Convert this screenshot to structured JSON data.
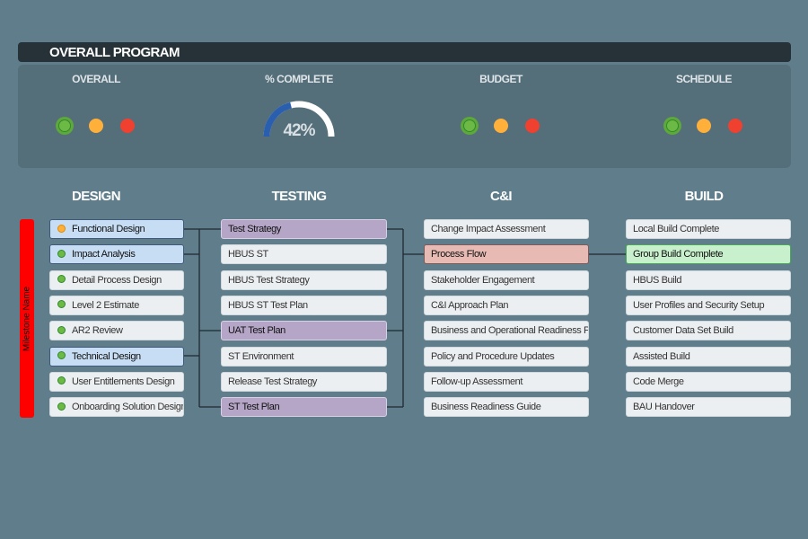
{
  "header": {
    "title": "OVERALL PROGRAM"
  },
  "kpis": {
    "overall": {
      "label": "OVERALL",
      "status": "green"
    },
    "complete": {
      "label": "% COMPLETE",
      "value": "42%",
      "percent": 42
    },
    "budget": {
      "label": "BUDGET",
      "status": "green"
    },
    "schedule": {
      "label": "SCHEDULE",
      "status": "green"
    }
  },
  "colors": {
    "green": "#6cba45",
    "amber": "#ffb03a",
    "red": "#f0402f",
    "gauge_fill": "#2a5fb0"
  },
  "milestone_label": "Milestone Name",
  "columns": [
    {
      "title": "DESIGN",
      "items": [
        {
          "label": "Functional Design",
          "status": "amber",
          "highlight": "blue"
        },
        {
          "label": "Impact Analysis",
          "status": "green",
          "highlight": "blue"
        },
        {
          "label": "Detail Process Design",
          "status": "green"
        },
        {
          "label": "Level 2 Estimate",
          "status": "green"
        },
        {
          "label": "AR2 Review",
          "status": "green"
        },
        {
          "label": "Technical Design",
          "status": "green",
          "highlight": "blue"
        },
        {
          "label": "User Entitlements Design",
          "status": "green"
        },
        {
          "label": "Onboarding Solution Design",
          "status": "green"
        }
      ]
    },
    {
      "title": "TESTING",
      "items": [
        {
          "label": "Test Strategy",
          "highlight": "purple"
        },
        {
          "label": "HBUS ST"
        },
        {
          "label": "HBUS Test Strategy"
        },
        {
          "label": "HBUS ST Test Plan"
        },
        {
          "label": "UAT Test Plan",
          "highlight": "purple"
        },
        {
          "label": "ST Environment"
        },
        {
          "label": "Release Test Strategy"
        },
        {
          "label": "ST Test Plan",
          "highlight": "purple"
        }
      ]
    },
    {
      "title": "C&I",
      "items": [
        {
          "label": "Change Impact Assessment"
        },
        {
          "label": "Process Flow",
          "highlight": "red"
        },
        {
          "label": "Stakeholder Engagement"
        },
        {
          "label": "C&I Approach Plan"
        },
        {
          "label": "Business and Operational Readiness Plan"
        },
        {
          "label": "Policy and Procedure Updates"
        },
        {
          "label": "Follow-up Assessment"
        },
        {
          "label": "Business Readiness Guide"
        }
      ]
    },
    {
      "title": "BUILD",
      "items": [
        {
          "label": "Local Build Complete"
        },
        {
          "label": "Group Build Complete",
          "highlight": "green"
        },
        {
          "label": "HBUS Build"
        },
        {
          "label": "User Profiles and Security Setup"
        },
        {
          "label": "Customer Data Set Build"
        },
        {
          "label": "Assisted Build"
        },
        {
          "label": "Code Merge"
        },
        {
          "label": "BAU Handover"
        }
      ]
    }
  ]
}
